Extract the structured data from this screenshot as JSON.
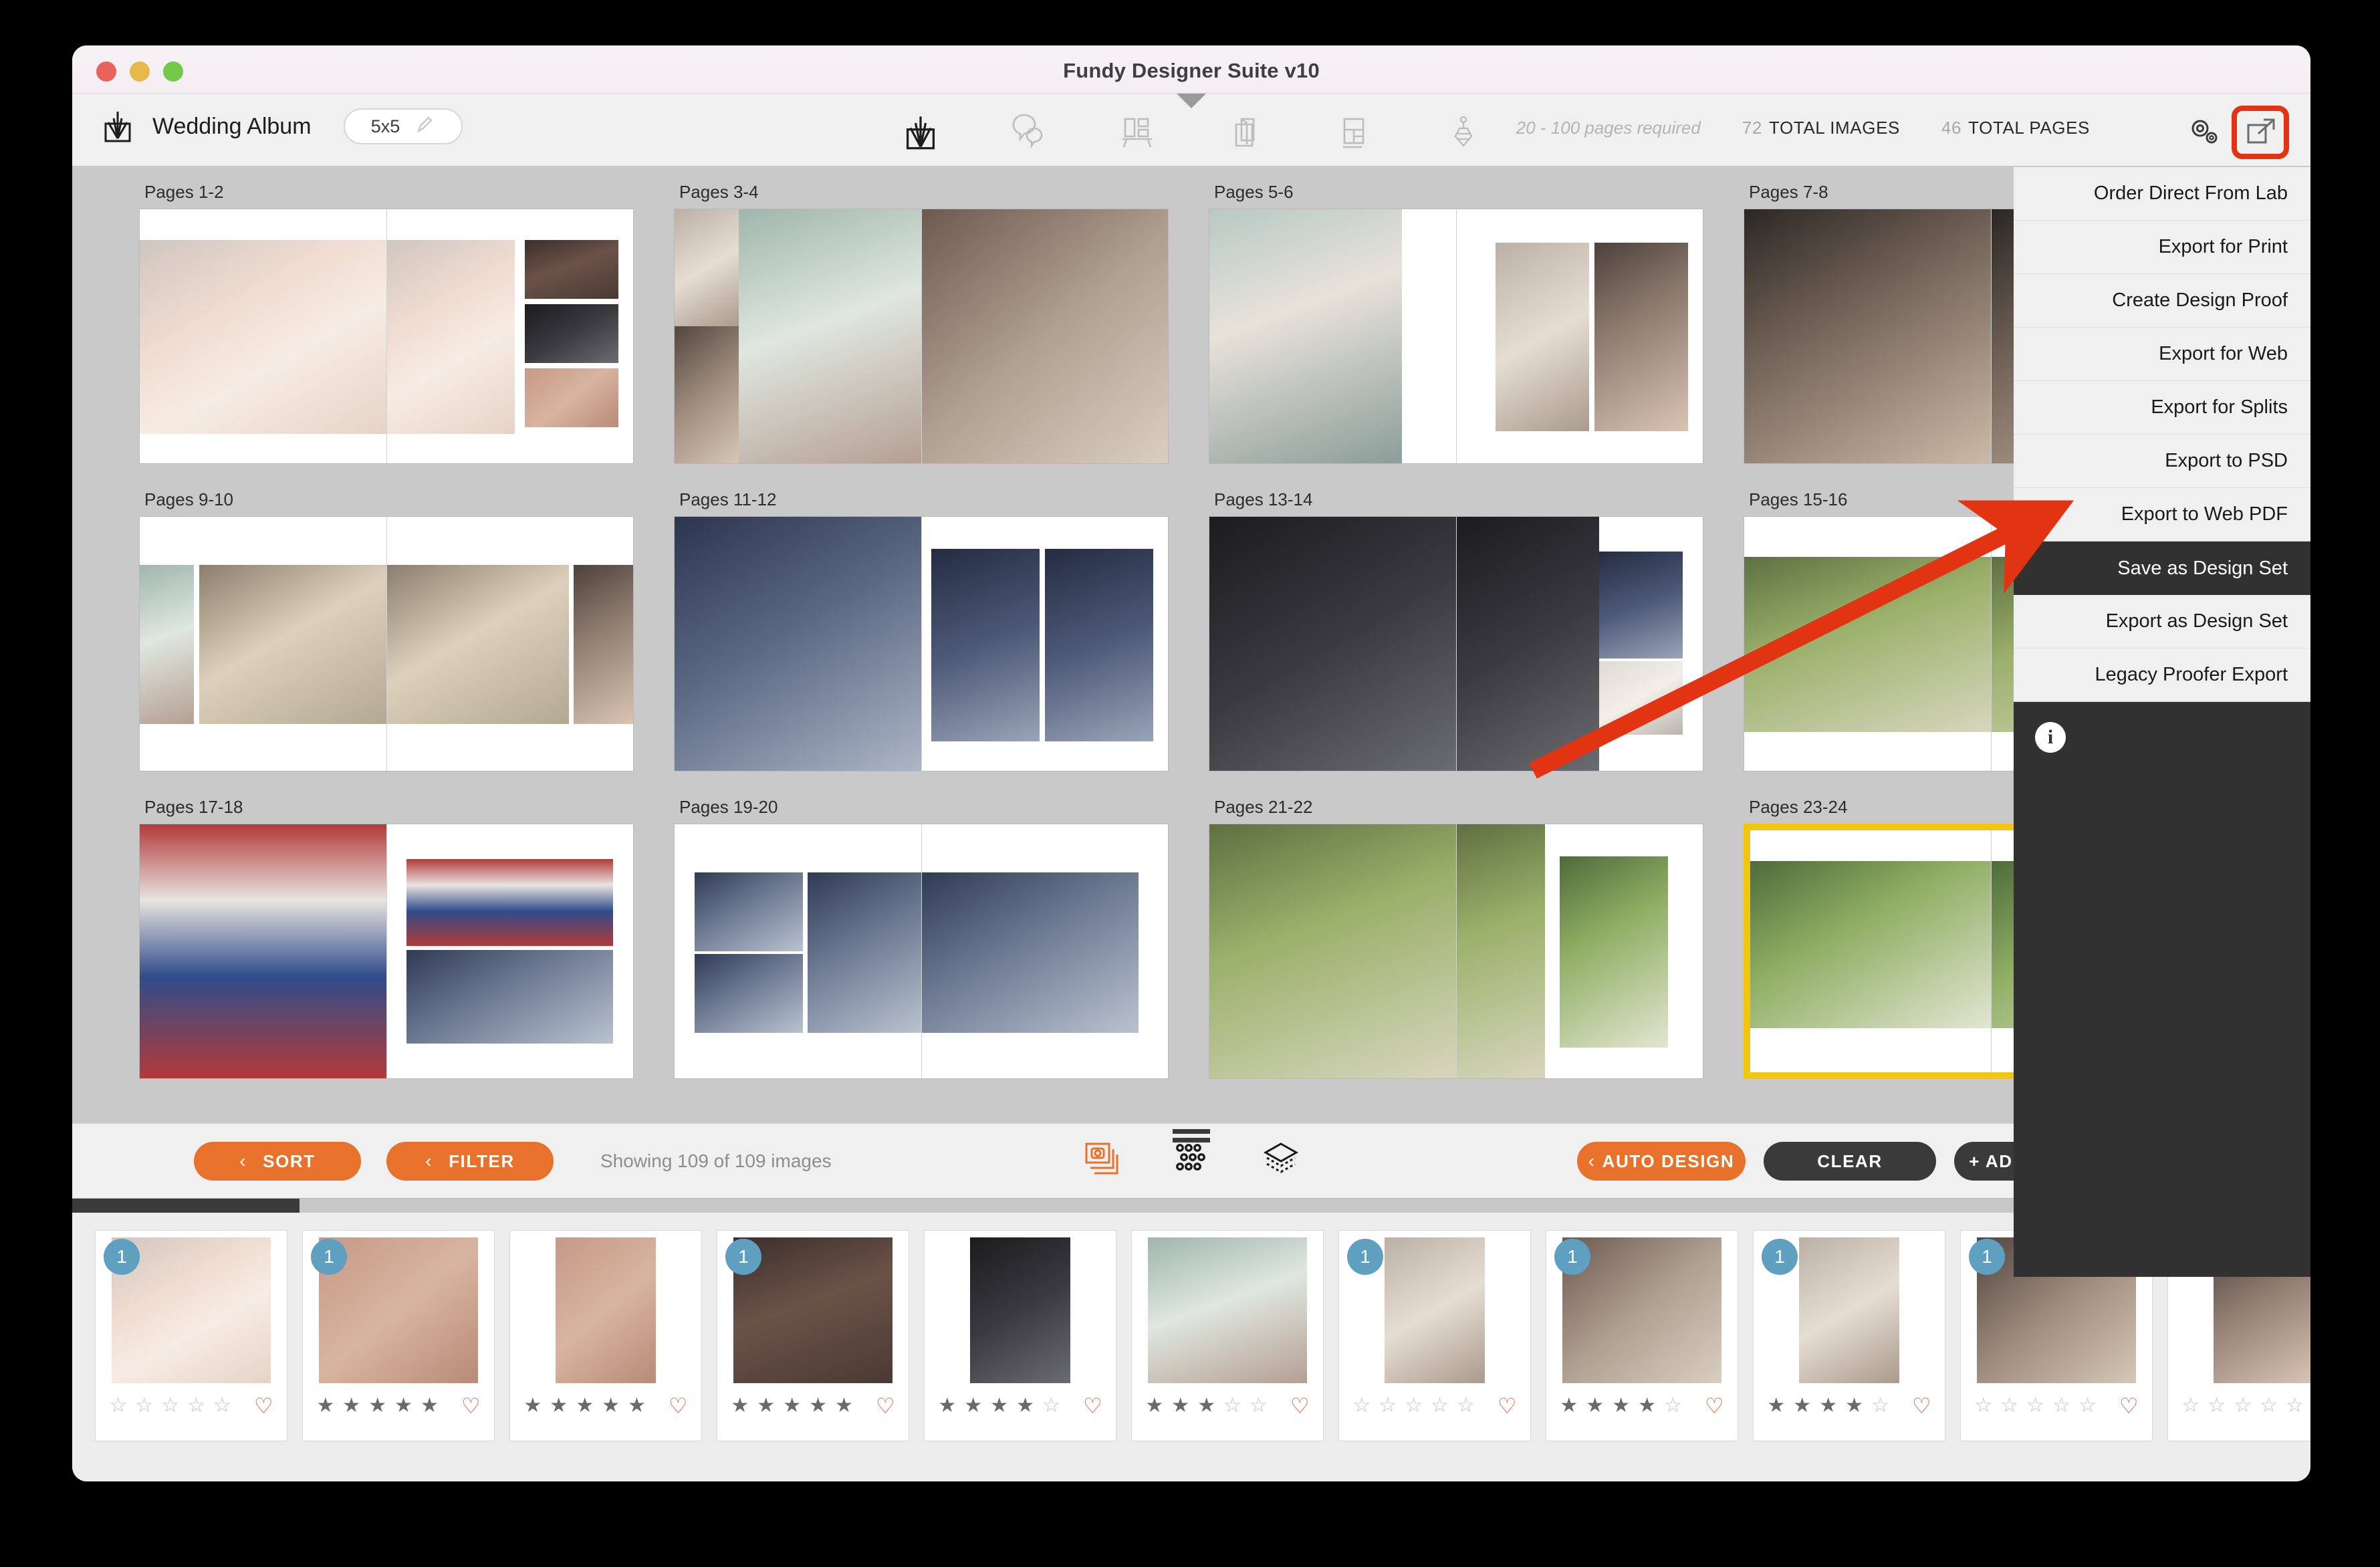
{
  "window": {
    "title": "Fundy Designer Suite v10",
    "traffic_lights": [
      "close",
      "minimize",
      "zoom"
    ]
  },
  "header": {
    "album_title": "Wedding Album",
    "size_value": "5x5",
    "edit_icon": "pencil-icon",
    "brand_icon": "fundy-logo-icon",
    "tools": [
      {
        "name": "album-design-tool",
        "icon": "fundy-album-icon",
        "active": true
      },
      {
        "name": "proofing-tool",
        "icon": "speech-bubbles-icon",
        "active": false
      },
      {
        "name": "wall-art-tool",
        "icon": "wall-art-icon",
        "active": false
      },
      {
        "name": "magazine-tool",
        "icon": "folded-book-icon",
        "active": false
      },
      {
        "name": "card-layout-tool",
        "icon": "card-layout-icon",
        "active": false
      },
      {
        "name": "print-tool",
        "icon": "print-stack-icon",
        "active": false
      }
    ],
    "pages_required": "20 - 100 pages required",
    "total_images_count": "72",
    "total_images_label": "TOTAL IMAGES",
    "total_pages_count": "46",
    "total_pages_label": "TOTAL PAGES",
    "gears_icon": "gears-icon",
    "export_icon": "export-arrow-icon"
  },
  "export_menu": {
    "items": [
      {
        "label": "Order Direct From Lab",
        "active": false
      },
      {
        "label": "Export for Print",
        "active": false
      },
      {
        "label": "Create Design Proof",
        "active": false
      },
      {
        "label": "Export for Web",
        "active": false
      },
      {
        "label": "Export for Splits",
        "active": false
      },
      {
        "label": "Export to PSD",
        "active": false
      },
      {
        "label": "Export to Web PDF",
        "active": false
      },
      {
        "label": "Save as Design Set",
        "active": true
      },
      {
        "label": "Export as Design Set",
        "active": false
      },
      {
        "label": "Legacy Proofer Export",
        "active": false
      }
    ],
    "info_icon": "info-icon",
    "info_glyph": "i"
  },
  "annotation": {
    "highlight_color": "#e23312",
    "arrow_color": "#e23312",
    "arrow_target": "Save as Design Set"
  },
  "spreads": [
    {
      "label": "Pages 1-2",
      "selected": false,
      "layout": "a"
    },
    {
      "label": "Pages 3-4",
      "selected": false,
      "layout": "b"
    },
    {
      "label": "Pages 5-6",
      "selected": false,
      "layout": "c"
    },
    {
      "label": "Pages 7-8",
      "selected": false,
      "layout": "d"
    },
    {
      "label": "Pages 9-10",
      "selected": false,
      "layout": "e"
    },
    {
      "label": "Pages 11-12",
      "selected": false,
      "layout": "f"
    },
    {
      "label": "Pages 13-14",
      "selected": false,
      "layout": "g"
    },
    {
      "label": "Pages 15-16",
      "selected": false,
      "layout": "h"
    },
    {
      "label": "Pages 17-18",
      "selected": false,
      "layout": "i"
    },
    {
      "label": "Pages 19-20",
      "selected": false,
      "layout": "j"
    },
    {
      "label": "Pages 21-22",
      "selected": false,
      "layout": "k"
    },
    {
      "label": "Pages 23-24",
      "selected": true,
      "layout": "l"
    }
  ],
  "bottom_toolbar": {
    "sort_label": "SORT",
    "filter_label": "FILTER",
    "chevron": "‹",
    "showing_text": "Showing 109 of 109 images",
    "auto_design_label": "AUTO DESIGN",
    "clear_label": "CLEAR",
    "add_photos_label": "+ ADD PHOTOS",
    "share_icon": "share-export-icon",
    "view_modes": [
      {
        "name": "photo-stack-view",
        "icon": "photo-stack-icon",
        "active": true
      },
      {
        "name": "grid-view",
        "icon": "dot-grid-icon",
        "active": false
      },
      {
        "name": "layers-view",
        "icon": "layers-icon",
        "active": false
      }
    ],
    "drag_handle": "drag-handle-icon"
  },
  "scrollbar": {
    "orientation": "horizontal",
    "thumb_position": "left"
  },
  "filmstrip": {
    "thumbs": [
      {
        "badge": "1",
        "rating": 0,
        "favorite": false,
        "photo": "g-dresses",
        "orientation": "landscape"
      },
      {
        "badge": "1",
        "rating": 5,
        "favorite": false,
        "photo": "g-necklace",
        "orientation": "landscape"
      },
      {
        "badge": "",
        "rating": 5,
        "favorite": false,
        "photo": "g-necklace",
        "orientation": "portrait"
      },
      {
        "badge": "1",
        "rating": 5,
        "favorite": false,
        "photo": "g-ring",
        "orientation": "landscape"
      },
      {
        "badge": "",
        "rating": 4,
        "favorite": false,
        "photo": "g-dark",
        "orientation": "portrait"
      },
      {
        "badge": "",
        "rating": 3,
        "favorite": false,
        "photo": "g-bride2",
        "orientation": "landscape"
      },
      {
        "badge": "1",
        "rating": 0,
        "favorite": false,
        "photo": "g-robe",
        "orientation": "portrait"
      },
      {
        "badge": "1",
        "rating": 4,
        "favorite": false,
        "photo": "g-hug",
        "orientation": "landscape"
      },
      {
        "badge": "1",
        "rating": 4,
        "favorite": false,
        "photo": "g-robe",
        "orientation": "portrait"
      },
      {
        "badge": "1",
        "rating": 0,
        "favorite": false,
        "photo": "g-flowergirl",
        "orientation": "landscape"
      },
      {
        "badge": "",
        "rating": 0,
        "favorite": false,
        "photo": "g-bride1",
        "orientation": "portrait"
      }
    ]
  }
}
